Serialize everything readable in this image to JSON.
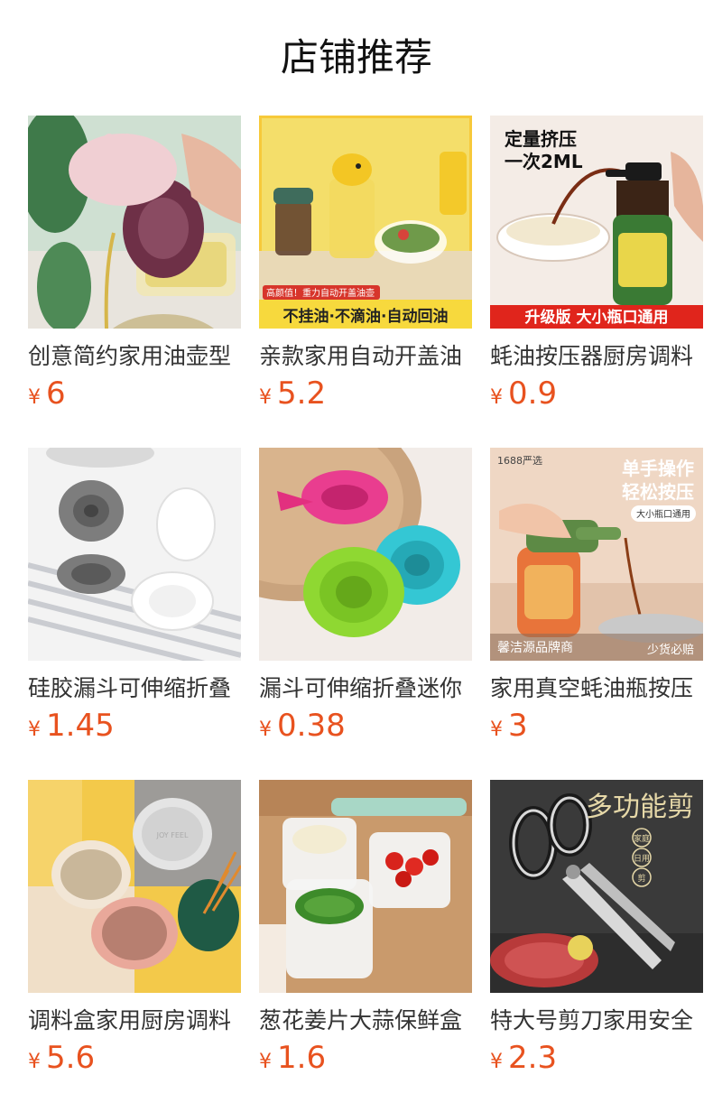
{
  "section": {
    "title": "店铺推荐"
  },
  "colors": {
    "price": "#e8521f",
    "title_text": "#333333"
  },
  "products": [
    {
      "title": "创意简约家用油壶型",
      "currency": "¥",
      "price": "6",
      "image_icon": "oil-pot-photo",
      "overlay": {}
    },
    {
      "title": "亲款家用自动开盖油",
      "currency": "¥",
      "price": "5.2",
      "image_icon": "auto-lid-oil-bottle-photo",
      "overlay": {
        "tag": "高颜值！重力自动开盖油壶",
        "banner": "不挂油·不滴油·自动回油"
      }
    },
    {
      "title": "蚝油按压器厨房调料",
      "currency": "¥",
      "price": "0.9",
      "image_icon": "oyster-sauce-pump-photo",
      "overlay": {
        "headline_1": "定量挤压",
        "headline_2": "一次2ML",
        "banner": "升级版  大小瓶口通用"
      }
    },
    {
      "title": "硅胶漏斗可伸缩折叠",
      "currency": "¥",
      "price": "1.45",
      "image_icon": "gray-silicone-funnel-photo",
      "overlay": {}
    },
    {
      "title": "漏斗可伸缩折叠迷你",
      "currency": "¥",
      "price": "0.38",
      "image_icon": "colorful-funnel-photo",
      "overlay": {}
    },
    {
      "title": "家用真空蚝油瓶按压",
      "currency": "¥",
      "price": "3",
      "image_icon": "vacuum-oyster-bottle-photo",
      "overlay": {
        "corner": "1688严选",
        "headline_1": "单手操作",
        "headline_2": "轻松按压",
        "tag": "大小瓶口通用",
        "shop": "馨洁源品牌商",
        "badge": "少货必赔"
      }
    },
    {
      "title": "调料盒家用厨房调料",
      "currency": "¥",
      "price": "5.6",
      "image_icon": "seasoning-box-photo",
      "overlay": {
        "lid_text": "JOY FEEL"
      }
    },
    {
      "title": "葱花姜片大蒜保鲜盒",
      "currency": "¥",
      "price": "1.6",
      "image_icon": "fresh-keeping-box-photo",
      "overlay": {}
    },
    {
      "title": "特大号剪刀家用安全",
      "currency": "¥",
      "price": "2.3",
      "image_icon": "kitchen-scissors-photo",
      "overlay": {
        "calligraphy": "多功能剪",
        "seal_1": "家庭",
        "seal_2": "日用",
        "seal_3": "剪"
      }
    }
  ]
}
